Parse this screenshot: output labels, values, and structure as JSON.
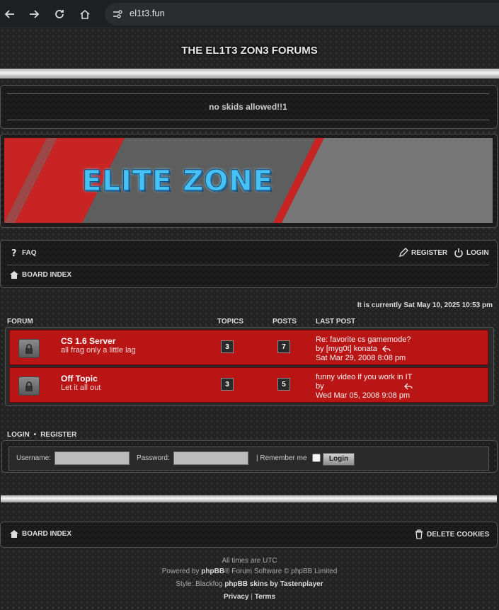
{
  "browser": {
    "url": "el1t3.fun",
    "back_icon": "arrow-left-icon",
    "forward_icon": "arrow-right-icon",
    "reload_icon": "reload-icon",
    "home_icon": "home-icon",
    "site_info_icon": "site-settings-icon"
  },
  "site": {
    "title": "THE EL1T3 ZON3 FORUMS",
    "tagline": "no skids allowed!!1",
    "banner_text": "ELITE ZONE"
  },
  "nav": {
    "faq": "FAQ",
    "register": "REGISTER",
    "login": "LOGIN",
    "board_index": "BOARD INDEX"
  },
  "current_time": "It is currently Sat May 10, 2025 10:53 pm",
  "forum_table": {
    "columns": [
      "FORUM",
      "TOPICS",
      "POSTS",
      "LAST POST"
    ],
    "rows": [
      {
        "title": "CS 1.6 Server",
        "description": "all frag only a little lag",
        "topics": "3",
        "posts": "7",
        "last_post_title": "Re: favorite cs gamemode?",
        "by": "by",
        "last_post_author": "[myg0t] konata",
        "last_post_time": "Sat Mar 29, 2008 8:08 pm"
      },
      {
        "title": "Off Topic",
        "description": "Let it all out",
        "topics": "3",
        "posts": "5",
        "last_post_title": "funny video if you work in IT",
        "by": "by",
        "last_post_author": "",
        "last_post_time": "Wed Mar 05, 2008 9:08 pm"
      }
    ]
  },
  "login_form": {
    "login_link": "LOGIN",
    "separator": "•",
    "register_link": "REGISTER",
    "username_label": "Username:",
    "password_label": "Password:",
    "remember_label": "| Remember me",
    "submit": "Login"
  },
  "footer": {
    "board_index": "BOARD INDEX",
    "delete_cookies": "DELETE COOKIES",
    "timezone": "All times are UTC",
    "powered_prefix": "Powered by",
    "powered_brand": "phpBB",
    "powered_suffix": "® Forum Software © phpBB Limited",
    "style_prefix": "Style: Blackfog",
    "style_brand": "phpBB skins by Tastenplayer",
    "privacy": "Privacy",
    "pipe": "|",
    "terms": "Terms"
  },
  "colors": {
    "forum_row": "#b91515",
    "banner_blue": "#47c0f2"
  }
}
